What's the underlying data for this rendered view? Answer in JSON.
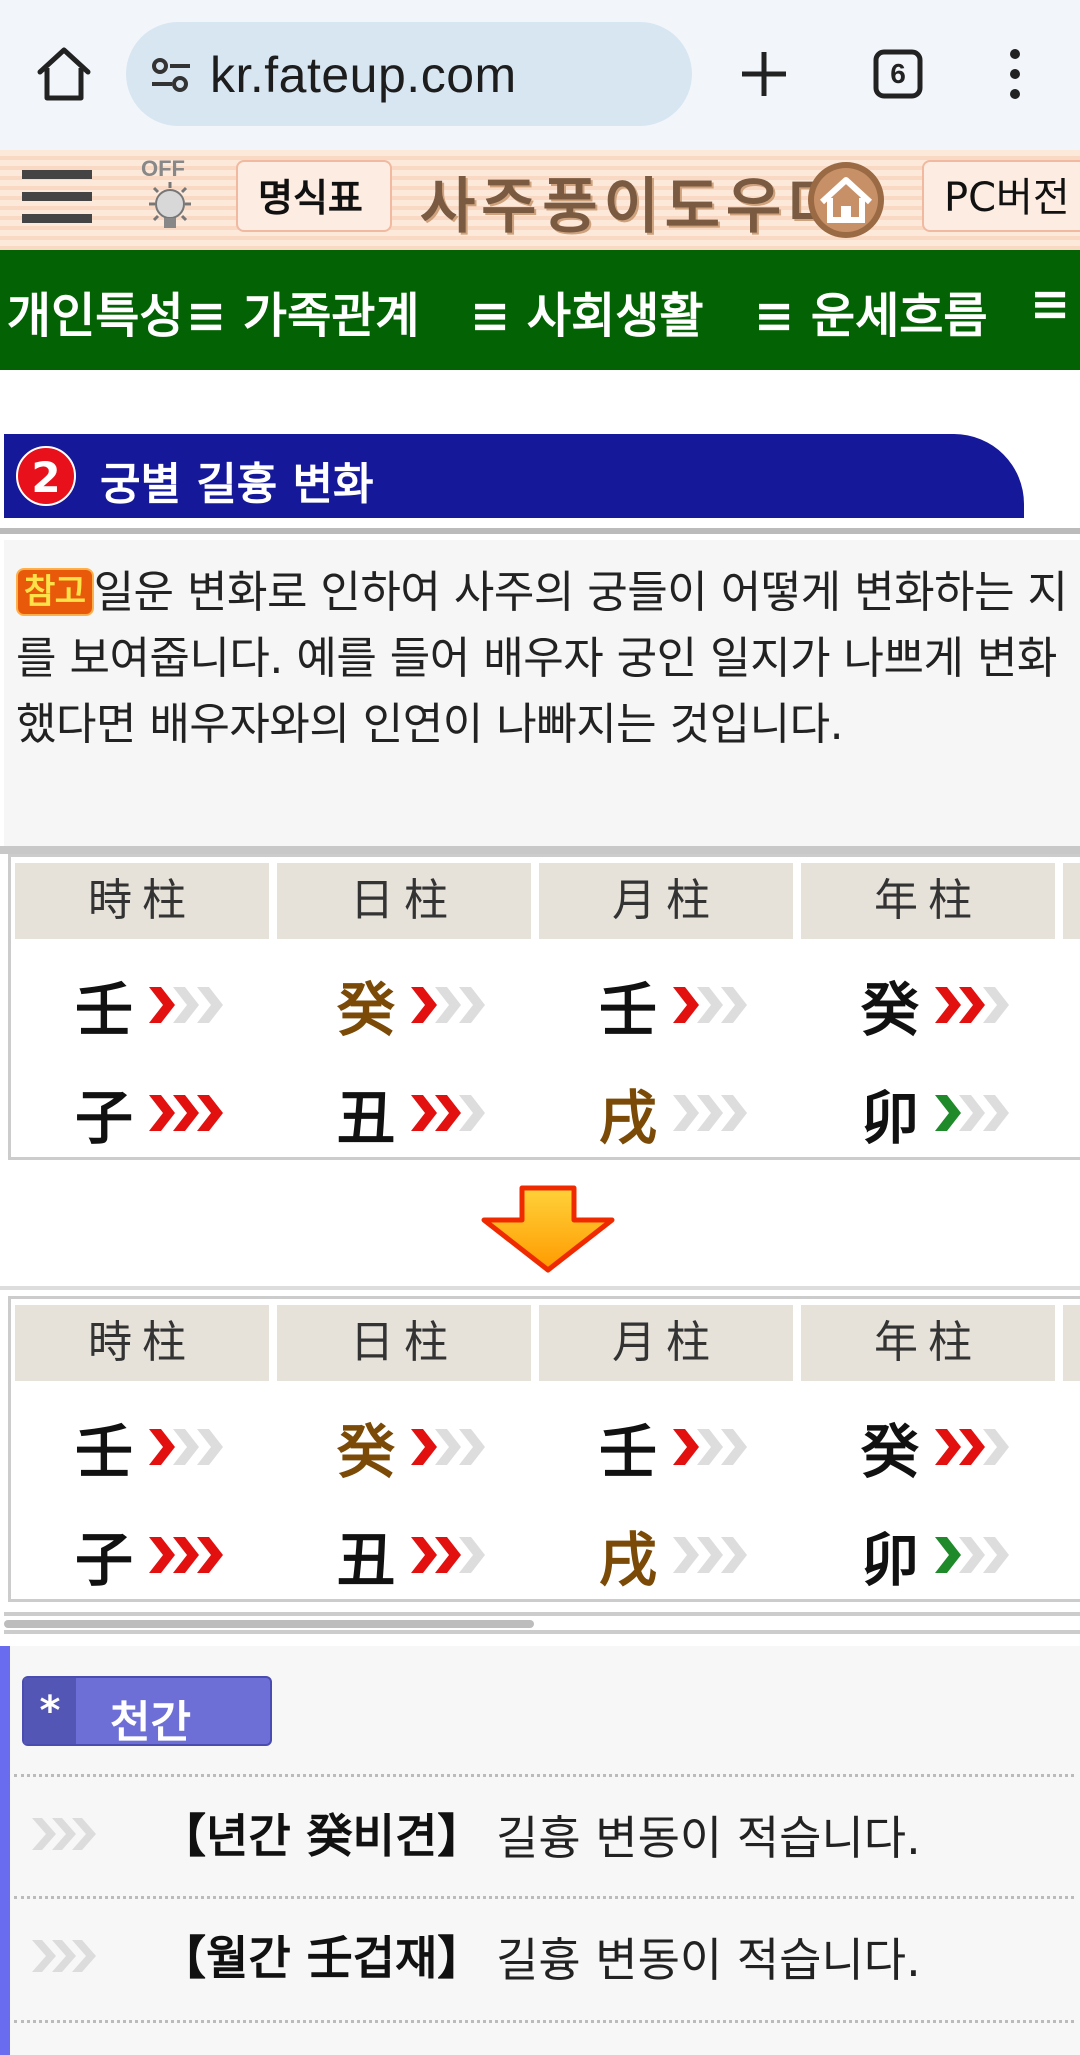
{
  "browser": {
    "url": "kr.fateup.com",
    "tab_count": "6"
  },
  "header": {
    "bulb_label": "OFF",
    "chart_button": "명식표",
    "logo_text": "사주풍이도우미",
    "pc_button": "PC버전"
  },
  "nav": {
    "items": [
      "≡ 개인특성",
      "≡ 가족관계",
      "≡ 사회생활",
      "≡ 운세흐름",
      "≡"
    ]
  },
  "section": {
    "number": "2",
    "title": "궁별 길흉 변화"
  },
  "info": {
    "badge": "참고",
    "text": "일운 변화로 인하여 사주의 궁들이 어떻게 변화하는 지를 보여줍니다. 예를 들어 배우자 궁인 일지가 나쁘게 변화했다면 배우자와의 인연이 나빠지는 것입니다."
  },
  "pillars_before": {
    "headers": [
      "時柱",
      "日柱",
      "月柱",
      "年柱"
    ],
    "stems": [
      {
        "char": "壬",
        "color": "dark",
        "chevrons": [
          "#e31010",
          "#dddddd",
          "#dddddd"
        ]
      },
      {
        "char": "癸",
        "color": "brown",
        "chevrons": [
          "#e31010",
          "#dddddd",
          "#dddddd"
        ]
      },
      {
        "char": "壬",
        "color": "dark",
        "chevrons": [
          "#e31010",
          "#dddddd",
          "#dddddd"
        ]
      },
      {
        "char": "癸",
        "color": "dark",
        "chevrons": [
          "#e31010",
          "#e31010",
          "#dddddd"
        ]
      }
    ],
    "branches": [
      {
        "char": "子",
        "color": "dark",
        "chevrons": [
          "#e31010",
          "#e31010",
          "#e31010"
        ]
      },
      {
        "char": "丑",
        "color": "dark",
        "chevrons": [
          "#e31010",
          "#e31010",
          "#dddddd"
        ]
      },
      {
        "char": "戌",
        "color": "brown",
        "chevrons": [
          "#dddddd",
          "#dddddd",
          "#dddddd"
        ]
      },
      {
        "char": "卯",
        "color": "dark",
        "chevrons": [
          "#1f8a2a",
          "#dddddd",
          "#dddddd"
        ]
      }
    ]
  },
  "pillars_after": {
    "headers": [
      "時柱",
      "日柱",
      "月柱",
      "年柱"
    ],
    "stems": [
      {
        "char": "壬",
        "color": "dark",
        "chevrons": [
          "#e31010",
          "#dddddd",
          "#dddddd"
        ]
      },
      {
        "char": "癸",
        "color": "brown",
        "chevrons": [
          "#e31010",
          "#dddddd",
          "#dddddd"
        ]
      },
      {
        "char": "壬",
        "color": "dark",
        "chevrons": [
          "#e31010",
          "#dddddd",
          "#dddddd"
        ]
      },
      {
        "char": "癸",
        "color": "dark",
        "chevrons": [
          "#e31010",
          "#e31010",
          "#dddddd"
        ]
      }
    ],
    "branches": [
      {
        "char": "子",
        "color": "dark",
        "chevrons": [
          "#e31010",
          "#e31010",
          "#e31010"
        ]
      },
      {
        "char": "丑",
        "color": "dark",
        "chevrons": [
          "#e31010",
          "#e31010",
          "#dddddd"
        ]
      },
      {
        "char": "戌",
        "color": "brown",
        "chevrons": [
          "#dddddd",
          "#dddddd",
          "#dddddd"
        ]
      },
      {
        "char": "卯",
        "color": "dark",
        "chevrons": [
          "#1f8a2a",
          "#dddddd",
          "#dddddd"
        ]
      }
    ]
  },
  "stems_section": {
    "star": "*",
    "title": "천간",
    "rows": [
      {
        "key": "【년간 癸비견】",
        "message": "길흉 변동이 적습니다."
      },
      {
        "key": "【월간 壬겁재】",
        "message": "길흉 변동이 적습니다."
      }
    ]
  },
  "colors": {
    "nav_green": "#036203",
    "title_blue": "#16189a",
    "accent_red": "#e31010",
    "accent_green": "#1f8a2a",
    "brown_glyph": "#7a4a06"
  }
}
